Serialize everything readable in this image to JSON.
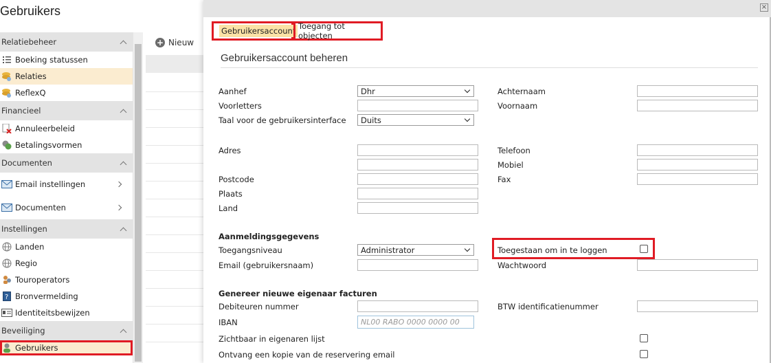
{
  "page": {
    "title": "Gebruikers"
  },
  "sidebar": {
    "sections": [
      {
        "title": "Relatiebeheer",
        "items": [
          {
            "label": "Boeking statussen",
            "icon": "list-icon"
          },
          {
            "label": "Relaties",
            "icon": "coins-icon"
          },
          {
            "label": "ReflexQ",
            "icon": "coins-icon"
          }
        ]
      },
      {
        "title": "Financieel",
        "items": [
          {
            "label": "Annuleerbeleid",
            "icon": "cancel-doc-icon"
          },
          {
            "label": "Betalingsvormen",
            "icon": "money-icon"
          }
        ]
      },
      {
        "title": "Documenten",
        "items": [
          {
            "label": "Email instellingen",
            "icon": "mail-icon"
          },
          {
            "label": "Documenten",
            "icon": "mail-icon"
          }
        ]
      },
      {
        "title": "Instellingen",
        "items": [
          {
            "label": "Landen",
            "icon": "globe-icon"
          },
          {
            "label": "Regio",
            "icon": "globe-icon"
          },
          {
            "label": "Touroperators",
            "icon": "users-icon"
          },
          {
            "label": "Bronvermelding",
            "icon": "book-icon"
          },
          {
            "label": "Identiteitsbewijzen",
            "icon": "id-card-icon"
          }
        ]
      },
      {
        "title": "Beveiliging",
        "items": [
          {
            "label": "Gebruikers",
            "icon": "user-icon"
          }
        ]
      }
    ]
  },
  "list": {
    "new_button": "Nieuw"
  },
  "modal": {
    "close_glyph": "×",
    "tabs": [
      "Gebruikersaccount",
      "Toegang tot objecten"
    ],
    "heading": "Gebruikersaccount beheren",
    "labels": {
      "aanhef": "Aanhef",
      "voorletters": "Voorletters",
      "taal": "Taal voor de gebruikersinterface",
      "achternaam": "Achternaam",
      "voornaam": "Voornaam",
      "adres": "Adres",
      "postcode": "Postcode",
      "plaats": "Plaats",
      "land": "Land",
      "telefoon": "Telefoon",
      "mobiel": "Mobiel",
      "fax": "Fax",
      "aanmelding_heading": "Aanmeldingsgegevens",
      "toegangsniveau": "Toegangsniveau",
      "email": "Email (gebruikersnaam)",
      "toegestaan": "Toegestaan om in te loggen",
      "wachtwoord": "Wachtwoord",
      "facturen_heading": "Genereer nieuwe eigenaar facturen",
      "debiteuren": "Debiteuren nummer",
      "btw": "BTW identificatienummer",
      "iban": "IBAN",
      "zichtbaar": "Zichtbaar in eigenaren lijst",
      "kopie": "Ontvang een kopie van de reservering email"
    },
    "values": {
      "aanhef": "Dhr",
      "taal": "Duits",
      "toegangsniveau": "Administrator",
      "iban_placeholder": "NL00 RABO 0000 0000 00"
    }
  },
  "colors": {
    "highlight": "#e01b24",
    "active_bg": "#fbecd0",
    "tab_bg": "#fbe2a6"
  }
}
